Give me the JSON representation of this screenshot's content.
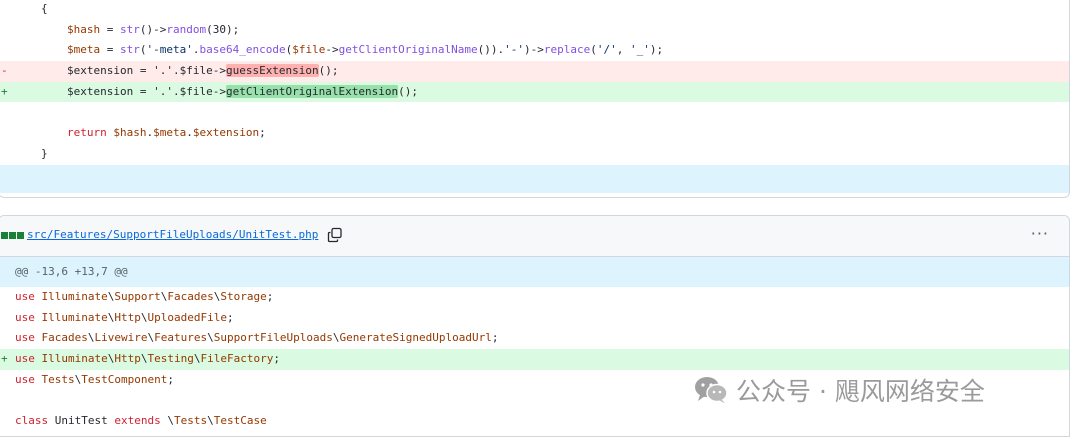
{
  "top_diff": {
    "lines": [
      {
        "type": "ctx",
        "marker": "",
        "indent": 42,
        "code": "{"
      },
      {
        "type": "ctx",
        "marker": "",
        "indent": 68,
        "code": "$hash = str()->random(30);"
      },
      {
        "type": "ctx",
        "marker": "",
        "indent": 68,
        "code": "$meta = str('-meta'.base64_encode($file->getClientOriginalName()).'-')->replace('/', '_');"
      },
      {
        "type": "del",
        "marker": "-",
        "indent": 68,
        "code_pre": "$extension = '.'.$file->",
        "code_hl": "guessExtension",
        "code_post": "();"
      },
      {
        "type": "add",
        "marker": "+",
        "indent": 68,
        "code_pre": "$extension = '.'.$file->",
        "code_hl": "getClientOriginalExtension",
        "code_post": "();"
      },
      {
        "type": "ctx",
        "marker": "",
        "indent": 68,
        "code": ""
      },
      {
        "type": "ctx",
        "marker": "",
        "indent": 68,
        "code": "return $hash.$meta.$extension;"
      },
      {
        "type": "ctx",
        "marker": "",
        "indent": 42,
        "code": "}"
      }
    ]
  },
  "file": {
    "path": "src/Features/SupportFileUploads/UnitTest.php",
    "more_label": "···",
    "hunk_header": "@@ -13,6 +13,7 @@",
    "lines": [
      {
        "type": "ctx",
        "marker": "",
        "code": "use Illuminate\\Support\\Facades\\Storage;"
      },
      {
        "type": "ctx",
        "marker": "",
        "code": "use Illuminate\\Http\\UploadedFile;"
      },
      {
        "type": "ctx",
        "marker": "",
        "code": "use Facades\\Livewire\\Features\\SupportFileUploads\\GenerateSignedUploadUrl;"
      },
      {
        "type": "add",
        "marker": "+",
        "code": "use Illuminate\\Http\\Testing\\FileFactory;"
      },
      {
        "type": "ctx",
        "marker": "",
        "code": "use Tests\\TestComponent;"
      },
      {
        "type": "ctx",
        "marker": "",
        "code": ""
      },
      {
        "type": "ctx",
        "marker": "",
        "code": "class UnitTest extends \\Tests\\TestCase"
      }
    ]
  },
  "watermark": {
    "text": "公众号 · 飓风网络安全",
    "icon": "wechat-icon"
  },
  "colors": {
    "deleted_bg": "#ffebe9",
    "added_bg": "#dafbe1",
    "expander_bg": "#ddf4ff",
    "link": "#0969da"
  }
}
